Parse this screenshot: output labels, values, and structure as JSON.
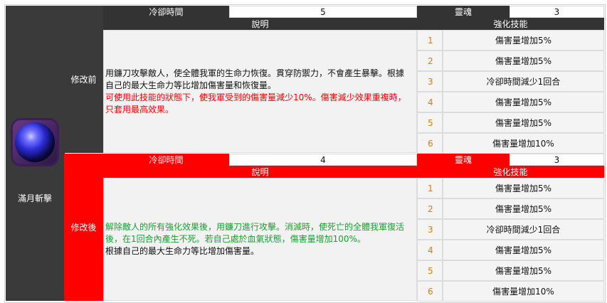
{
  "skill": {
    "name": "滿月斬擊",
    "icon": "full-moon-icon"
  },
  "before": {
    "stage_label": "修改前",
    "cooldown_label": "冷卻時間",
    "cooldown_value": "5",
    "soul_label": "靈魂",
    "soul_value": "3",
    "desc_header": "說明",
    "enhance_header": "強化技能",
    "desc_lines": [
      "用鐮刀攻擊敵人，使全體我軍的生命力恢復。貫穿防禦力，不會產生暴擊。根據自己的最大生命力等比增加傷害量和恢復量。",
      "可使用此技能的狀態下，使我軍受到的傷害量減少10%。傷害減少效果重複時，只套用最高效果。"
    ],
    "enhancements": [
      {
        "level": "1",
        "effect": "傷害量增加5%"
      },
      {
        "level": "2",
        "effect": "傷害量增加5%"
      },
      {
        "level": "3",
        "effect": "冷卻時間減少1回合"
      },
      {
        "level": "4",
        "effect": "傷害量增加5%"
      },
      {
        "level": "5",
        "effect": "傷害量增加5%"
      },
      {
        "level": "6",
        "effect": "傷害量增加10%"
      }
    ]
  },
  "after": {
    "stage_label": "修改後",
    "cooldown_label": "冷卻時間",
    "cooldown_value": "4",
    "soul_label": "靈魂",
    "soul_value": "3",
    "desc_header": "說明",
    "enhance_header": "強化技能",
    "desc_lines": [
      "解除敵人的所有強化效果後，用鐮刀進行攻擊。消滅時，使死亡的全體我軍復活後，在1回合內產生不死。若自己處於血氣狀態，傷害量增加100%。",
      "根據自己的最大生命力等比增加傷害量。"
    ],
    "enhancements": [
      {
        "level": "1",
        "effect": "傷害量增加5%"
      },
      {
        "level": "2",
        "effect": "傷害量增加5%"
      },
      {
        "level": "3",
        "effect": "冷卻時間減少1回合"
      },
      {
        "level": "4",
        "effect": "傷害量增加5%"
      },
      {
        "level": "5",
        "effect": "傷害量增加5%"
      },
      {
        "level": "6",
        "effect": "傷害量增加10%"
      }
    ]
  },
  "colors": {
    "dark_header": "#333333",
    "red_header": "#ff0000",
    "level_number": "#e07a10",
    "green_text": "#1aa032"
  }
}
